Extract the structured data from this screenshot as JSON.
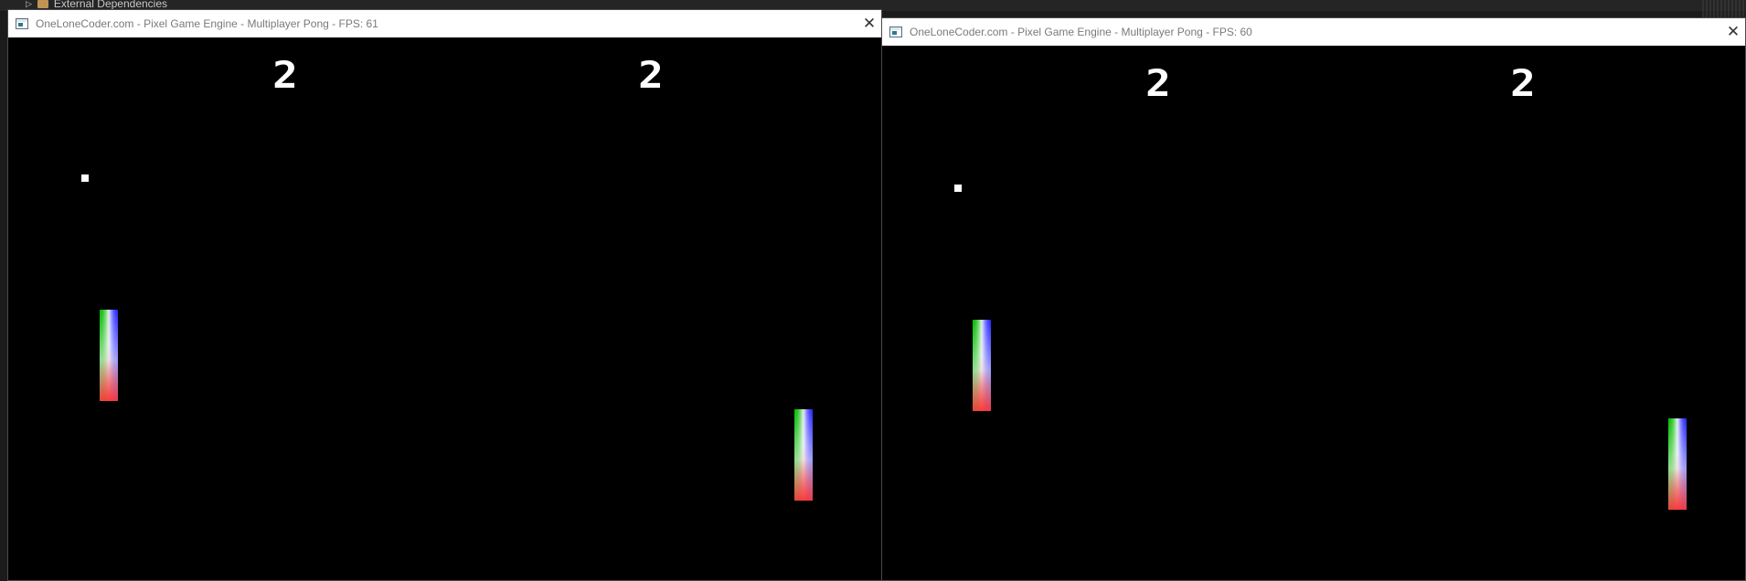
{
  "ide": {
    "tree_item_label": "External Dependencies"
  },
  "windows": [
    {
      "title": "OneLoneCoder.com - Pixel Game Engine - Multiplayer Pong - FPS: 61",
      "close_label": "✕",
      "scores": {
        "left": "2",
        "right": "2"
      }
    },
    {
      "title": "OneLoneCoder.com - Pixel Game Engine - Multiplayer Pong - FPS: 60",
      "close_label": "✕",
      "scores": {
        "left": "2",
        "right": "2"
      }
    }
  ],
  "colors": {
    "background": "#000000",
    "titlebar": "#ffffff",
    "ball": "#ffffff",
    "paddle_gradient": [
      "#00b000",
      "#ffffff",
      "#1a1aff",
      "#ff2a2a"
    ]
  }
}
